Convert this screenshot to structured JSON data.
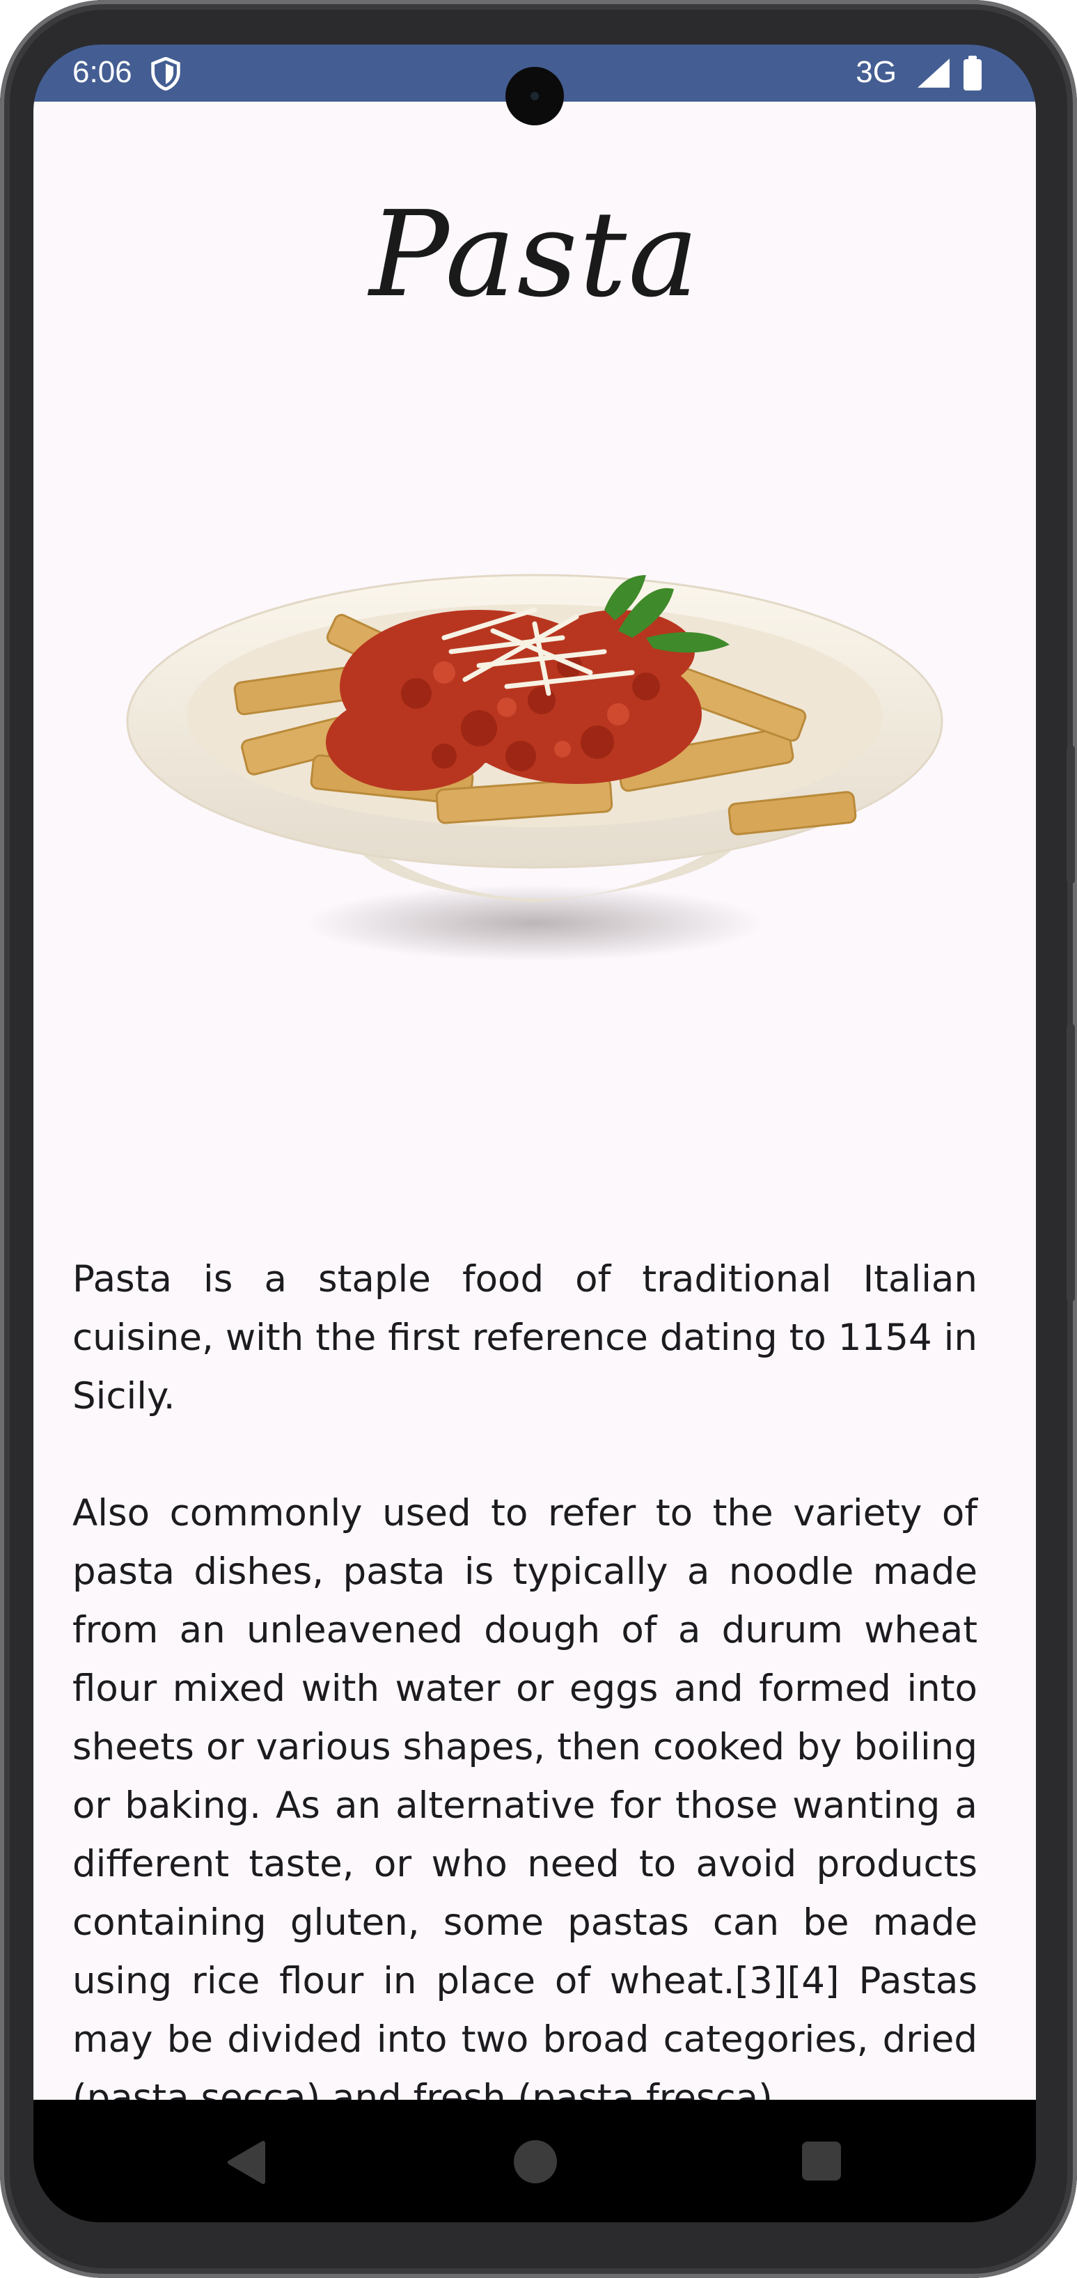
{
  "status_bar": {
    "time": "6:06",
    "network": "3G",
    "icons": [
      "shield-icon",
      "signal-icon",
      "battery-icon"
    ],
    "background_color": "#445e93"
  },
  "page": {
    "title": "Pasta",
    "image_name": "pasta-dish-image",
    "paragraphs": [
      "Pasta is a staple food of traditional Italian cuisine, with the first reference dating to 1154 in Sicily.",
      "Also commonly used to refer to the variety of pasta dishes, pasta is typically a noodle made from an unleavened dough of a durum wheat flour mixed with water or eggs and formed into sheets or various shapes, then cooked by boiling or baking. As an alternative for those wanting a different taste, or who need to avoid products containing gluten, some pastas can be made using rice flour in place of wheat.[3][4] Pastas may be divided into two broad categories, dried (pasta secca) and fresh (pasta fresca)."
    ],
    "background_color": "#fcf8fc"
  },
  "nav_bar": {
    "icons": [
      "back-icon",
      "home-icon",
      "recents-icon"
    ]
  }
}
